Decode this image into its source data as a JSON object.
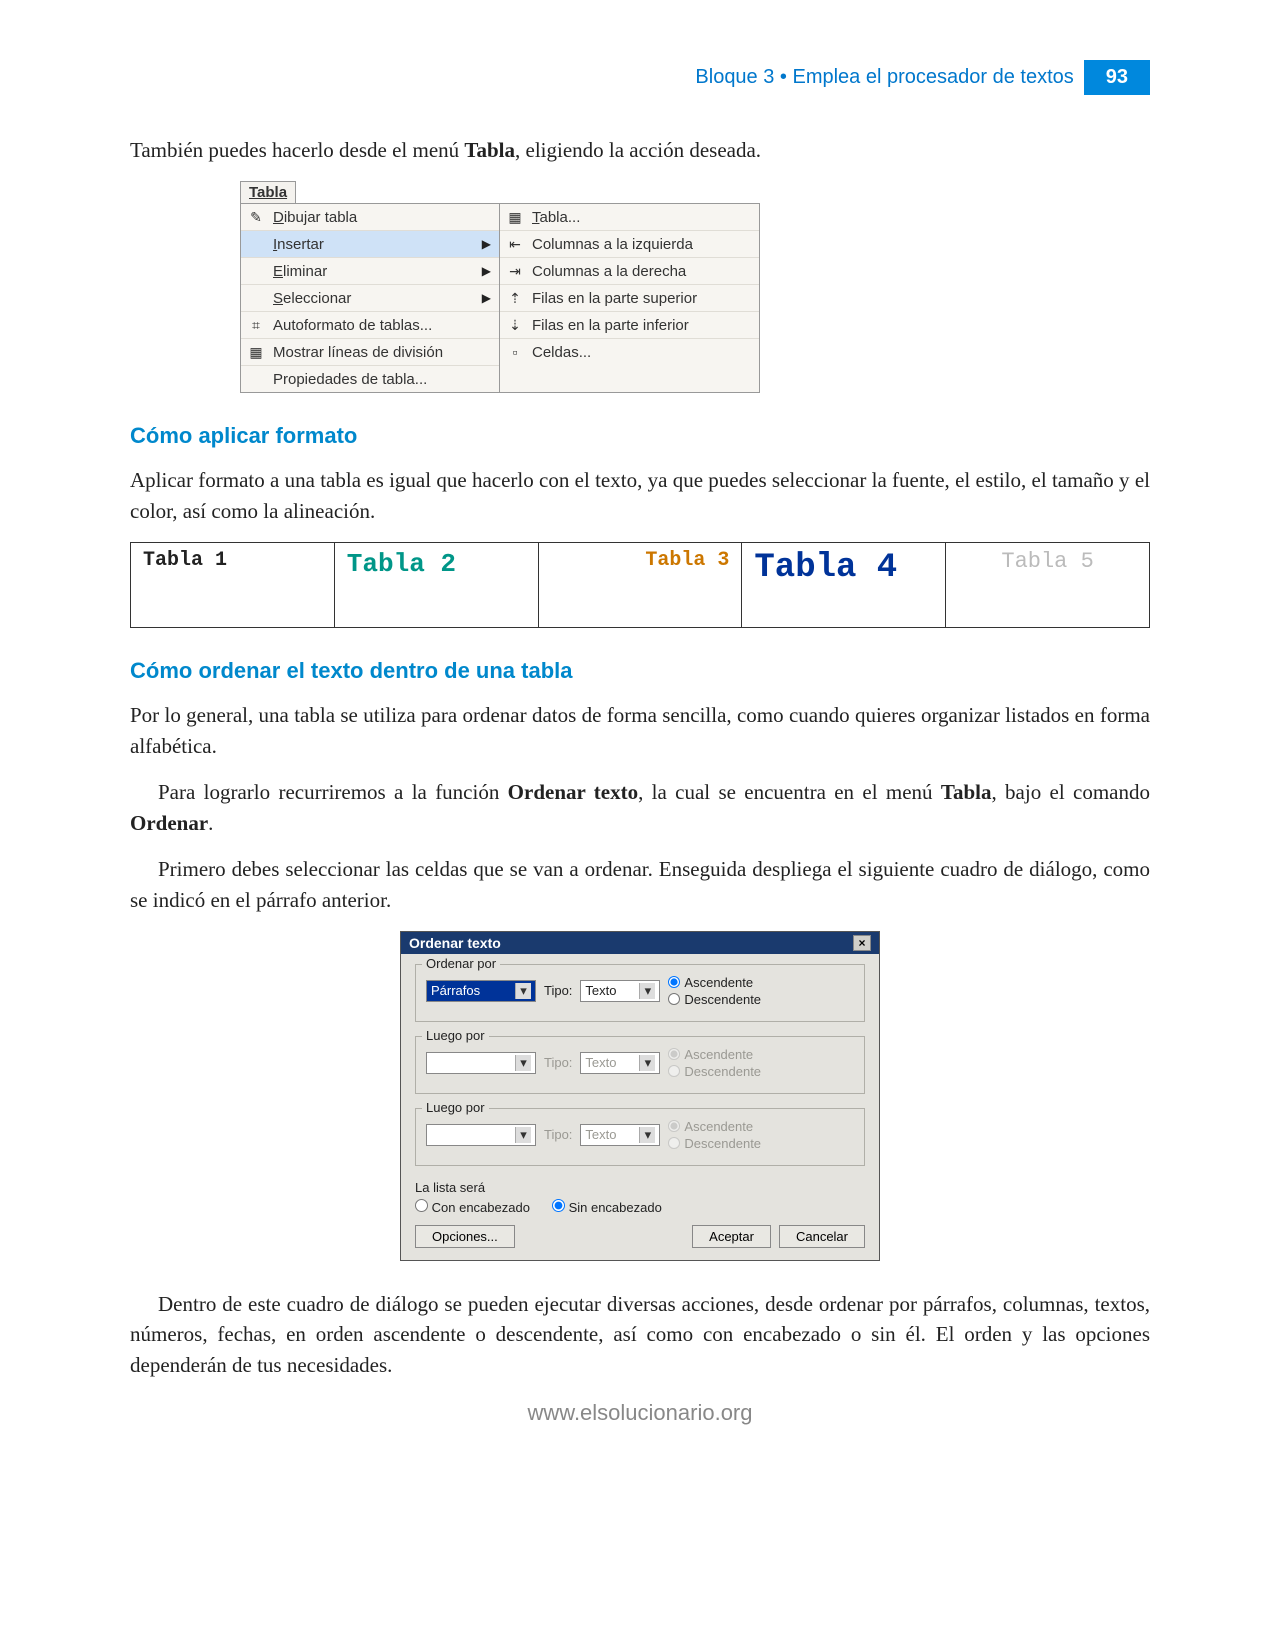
{
  "header": {
    "block_text": "Bloque 3 • Emplea el procesador de textos",
    "page_number": "93"
  },
  "intro": {
    "text_prefix": "También puedes hacerlo desde el menú ",
    "bold_word": "Tabla",
    "text_suffix": ", eligiendo la acción deseada."
  },
  "menu": {
    "title": "Tabla",
    "left": [
      {
        "icon": "✎",
        "label": "Dibujar tabla"
      },
      {
        "icon": "",
        "label": "Insertar",
        "arrow": "▶",
        "hl": true
      },
      {
        "icon": "",
        "label": "Eliminar",
        "arrow": "▶"
      },
      {
        "icon": "",
        "label": "Seleccionar",
        "arrow": "▶"
      },
      {
        "icon": "⌗",
        "label": "Autoformato de tablas..."
      },
      {
        "icon": "▦",
        "label": "Mostrar líneas de división"
      },
      {
        "icon": "",
        "label": "Propiedades de tabla..."
      }
    ],
    "right": [
      {
        "icon": "▦",
        "label": "Tabla..."
      },
      {
        "icon": "⇤",
        "label": "Columnas a la izquierda"
      },
      {
        "icon": "⇥",
        "label": "Columnas a la derecha"
      },
      {
        "icon": "⇡",
        "label": "Filas en la parte superior"
      },
      {
        "icon": "⇣",
        "label": "Filas en la parte inferior"
      },
      {
        "icon": "▫",
        "label": "Celdas..."
      }
    ]
  },
  "section_format": {
    "heading": "Cómo aplicar formato",
    "paragraph": "Aplicar formato a una tabla es igual que hacerlo con el texto, ya que puedes seleccionar la fuente, el estilo, el tamaño y el color, así como la alineación."
  },
  "table_examples": [
    "Tabla 1",
    "Tabla 2",
    "Tabla 3",
    "Tabla 4",
    "Tabla 5"
  ],
  "section_sort": {
    "heading": "Cómo ordenar el texto dentro de una tabla",
    "p1": "Por lo general, una tabla se utiliza para ordenar datos de forma sencilla, como cuando quieres organizar listados en forma alfabética.",
    "p2a": "Para lograrlo recurriremos a la función ",
    "p2b": "Ordenar texto",
    "p2c": ", la cual se encuentra en el menú ",
    "p2d": "Tabla",
    "p2e": ", bajo el comando ",
    "p2f": "Ordenar",
    "p2g": ".",
    "p3": "Primero debes seleccionar las celdas que se van a ordenar. Enseguida despliega el siguiente cuadro de diálogo, como se indicó en el párrafo anterior."
  },
  "dialog": {
    "title": "Ordenar texto",
    "sort_by": "Ordenar por",
    "then_by": "Luego por",
    "field_value": "Párrafos",
    "type_label": "Tipo:",
    "type_value": "Texto",
    "asc": "Ascendente",
    "desc": "Descendente",
    "list_will_be": "La lista será",
    "with_header": "Con encabezado",
    "without_header": "Sin encabezado",
    "options": "Opciones...",
    "accept": "Aceptar",
    "cancel": "Cancelar"
  },
  "closing": "Dentro de este cuadro de diálogo se pueden ejecutar diversas acciones, desde ordenar por párrafos, columnas, textos, números, fechas, en orden ascendente o descendente, así como con encabezado o sin él. El orden y las opciones dependerán de tus necesidades.",
  "footer_url": "www.elsolucionario.org"
}
